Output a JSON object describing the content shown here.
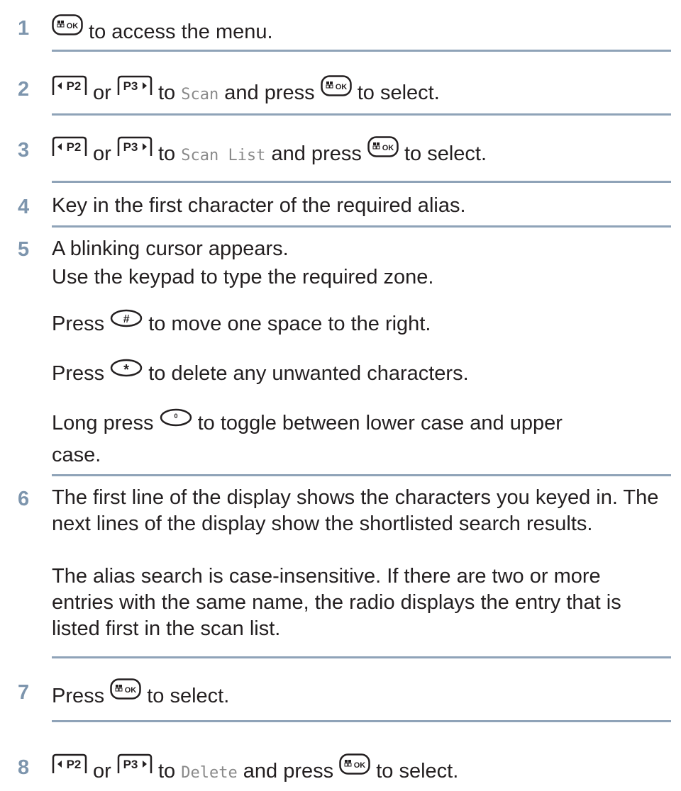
{
  "steps": [
    {
      "n": "1",
      "after_key": " to access the menu."
    },
    {
      "n": "2",
      "or": " or ",
      "to": " to ",
      "target": "Scan",
      "press": " and press ",
      "end": " to select."
    },
    {
      "n": "3",
      "or": " or ",
      "to": " to ",
      "target": "Scan List",
      "press": " and press ",
      "end": " to select."
    },
    {
      "n": "4",
      "text": "Key in the first character of the required alias."
    },
    {
      "n": "5",
      "text1": "A blinking cursor appears.",
      "text2": "Use the keypad to type the required zone.",
      "press_word": "Press ",
      "hash_text": " to move one space to the right.",
      "star_text": " to delete any unwanted characters.",
      "long_press": "Long press ",
      "zero_text": " to toggle between lower case and upper",
      "zero_text2": "case."
    },
    {
      "n": "6",
      "text1": "The first line of the display shows the characters you keyed in. The next lines of the display show the shortlisted search results.",
      "text2": "The alias search is case-insensitive. If there are two or more entries with the same name, the radio displays the entry that is listed first in the scan list."
    },
    {
      "n": "7",
      "press_word": "Press ",
      "end": " to select."
    },
    {
      "n": "8",
      "or": " or ",
      "to": " to ",
      "target": "Delete",
      "press": " and press ",
      "end": " to select."
    }
  ],
  "keys": {
    "menu_ok": "OK",
    "p2": "P2",
    "p3": "P3",
    "hash": "#",
    "star": "*",
    "zero": "0"
  },
  "colors": {
    "step_number": "#7d95ad",
    "rule": "#8fa3b8",
    "mono_text": "#8a8a8a"
  }
}
